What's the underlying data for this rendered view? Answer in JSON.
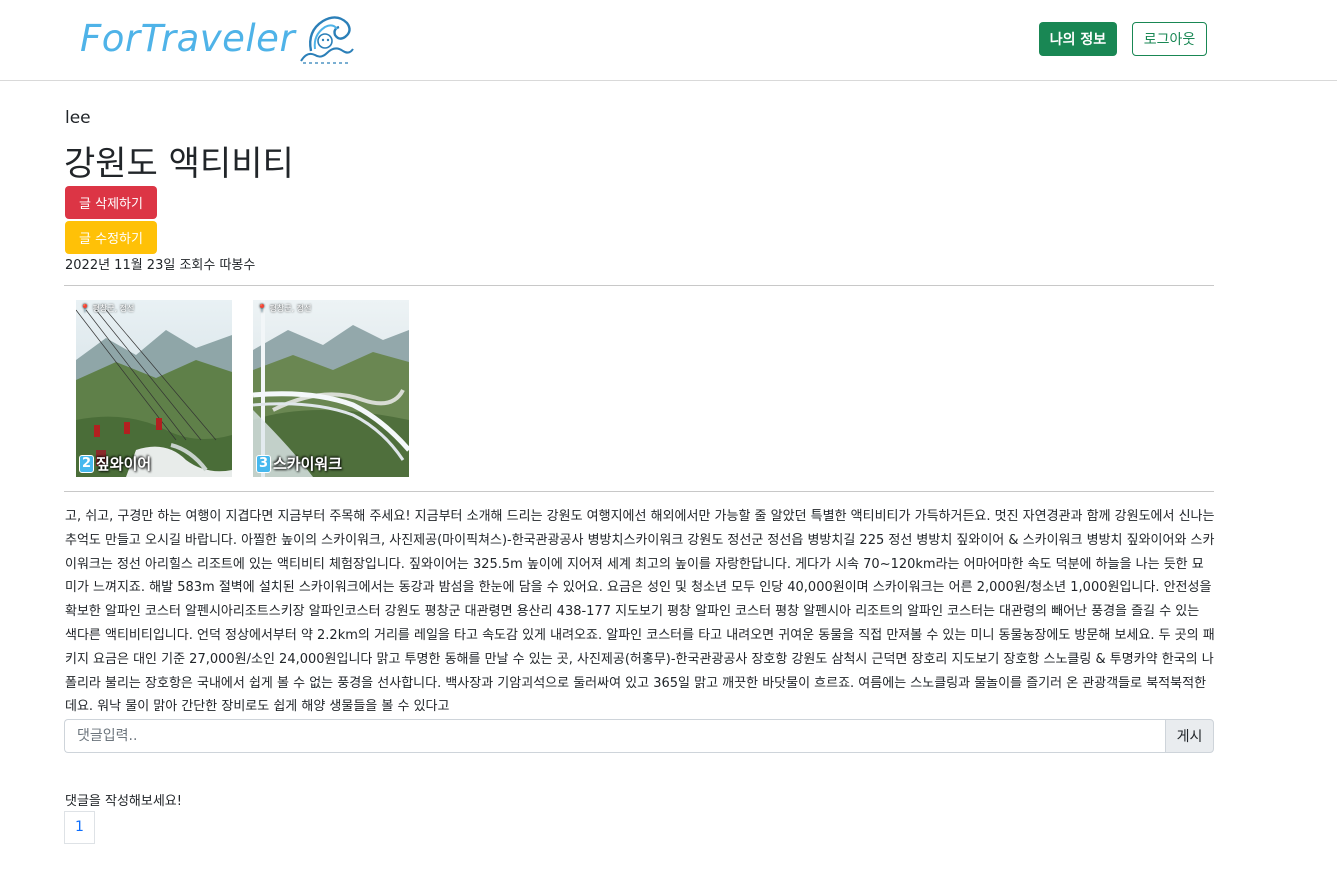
{
  "header": {
    "logo_text": "ForTraveler",
    "logo_icon": "wave-mascot-icon",
    "myinfo_label": "나의 정보",
    "logout_label": "로그아웃",
    "brand_color": "#4fb3e8",
    "primary_color": "#198754"
  },
  "post": {
    "author": "lee",
    "title": "강원도 액티비티",
    "delete_label": "글 삭제하기",
    "edit_label": "글 수정하기",
    "meta": "2022년 11월 23일 조회수 따봉수",
    "images": [
      {
        "location": "📍 평창군, 정선",
        "number": "2",
        "caption": "짚와이어"
      },
      {
        "location": "📍 평창군, 정선",
        "number": "3",
        "caption": "스카이워크"
      }
    ],
    "content": "고, 쉬고, 구경만 하는 여행이 지겹다면 지금부터 주목해 주세요! 지금부터 소개해 드리는 강원도 여행지에선 해외에서만 가능할 줄 알았던 특별한 액티비티가 가득하거든요. 멋진 자연경관과 함께 강원도에서 신나는 추억도 만들고 오시길 바랍니다. 아찔한 높이의 스카이워크, 사진제공(마이픽쳐스)-한국관광공사 병방치스카이워크 강원도 정선군 정선읍 병방치길 225 정선 병방치 짚와이어 & 스카이워크 병방치 짚와이어와 스카이워크는 정선 아리힐스 리조트에 있는 액티비티 체험장입니다. 짚와이어는 325.5m 높이에 지어져 세계 최고의 높이를 자랑한답니다. 게다가 시속 70~120km라는 어마어마한 속도 덕분에 하늘을 나는 듯한 묘미가 느껴지죠. 해발 583m 절벽에 설치된 스카이워크에서는 동강과 밤섬을 한눈에 담을 수 있어요. 요금은 성인 및 청소년 모두 인당 40,000원이며 스카이워크는 어른 2,000원/청소년 1,000원입니다. 안전성을 확보한 알파인 코스터 알펜시아리조트스키장 알파인코스터 강원도 평창군 대관령면 용산리 438-177 지도보기 평창 알파인 코스터 평창 알펜시아 리조트의 알파인 코스터는 대관령의 빼어난 풍경을 즐길 수 있는 색다른 액티비티입니다. 언덕 정상에서부터 약 2.2km의 거리를 레일을 타고 속도감 있게 내려오죠. 알파인 코스터를 타고 내려오면 귀여운 동물을 직접 만져볼 수 있는 미니 동물농장에도 방문해 보세요. 두 곳의 패키지 요금은 대인 기준 27,000원/소인 24,000원입니다 맑고 투명한 동해를 만날 수 있는 곳, 사진제공(허홍무)-한국관광공사 장호항 강원도 삼척시 근덕면 장호리 지도보기 장호항 스노클링 & 투명카약 한국의 나폴리라 불리는 장호항은 국내에서 쉽게 볼 수 없는 풍경을 선사합니다. 백사장과 기암괴석으로 둘러싸여 있고 365일 맑고 깨끗한 바닷물이 흐르죠. 여름에는 스노클링과 물놀이를 즐기러 온 관광객들로 북적북적한데요. 워낙 물이 맑아 간단한 장비로도 쉽게 해양 생물들을 볼 수 있다고"
  },
  "comments": {
    "input_placeholder": "댓글입력..",
    "input_value": "",
    "post_label": "게시",
    "empty_message": "댓글을 작성해보세요!",
    "pages": [
      "1"
    ]
  },
  "colors": {
    "delete": "#dc3545",
    "edit": "#ffc107",
    "link": "#0d6efd"
  }
}
